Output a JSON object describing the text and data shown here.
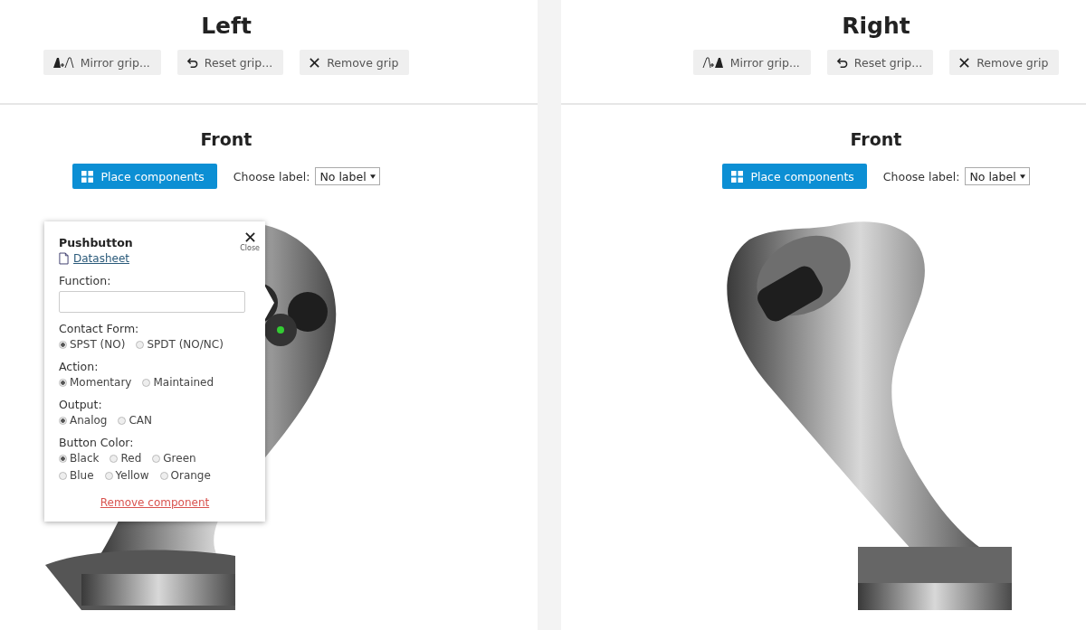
{
  "panels": [
    {
      "title": "Left",
      "buttons": [
        {
          "kind": "mirror",
          "label": "Mirror grip..."
        },
        {
          "kind": "reset",
          "label": "Reset grip..."
        },
        {
          "kind": "remove",
          "label": "Remove grip"
        }
      ],
      "view": {
        "title": "Front",
        "place_button": "Place components",
        "label_caption": "Choose label:",
        "label_value": "No label"
      },
      "popup": {
        "title": "Pushbutton",
        "close": "Close",
        "datasheet": "Datasheet",
        "function_label": "Function:",
        "groups": [
          {
            "label": "Contact Form:",
            "options": [
              {
                "label": "SPST (NO)",
                "selected": true
              },
              {
                "label": "SPDT (NO/NC)",
                "selected": false
              }
            ]
          },
          {
            "label": "Action:",
            "options": [
              {
                "label": "Momentary",
                "selected": true
              },
              {
                "label": "Maintained",
                "selected": false
              }
            ]
          },
          {
            "label": "Output:",
            "options": [
              {
                "label": "Analog",
                "selected": true
              },
              {
                "label": "CAN",
                "selected": false
              }
            ]
          },
          {
            "label": "Button Color:",
            "options": [
              {
                "label": "Black",
                "selected": true
              },
              {
                "label": "Red",
                "selected": false
              },
              {
                "label": "Green",
                "selected": false
              },
              {
                "label": "Blue",
                "selected": false
              },
              {
                "label": "Yellow",
                "selected": false
              },
              {
                "label": "Orange",
                "selected": false
              }
            ]
          }
        ],
        "remove": "Remove component"
      }
    },
    {
      "title": "Right",
      "buttons": [
        {
          "kind": "mirror",
          "label": "Mirror grip..."
        },
        {
          "kind": "reset",
          "label": "Reset grip..."
        },
        {
          "kind": "remove",
          "label": "Remove grip"
        }
      ],
      "view": {
        "title": "Front",
        "place_button": "Place components",
        "label_caption": "Choose label:",
        "label_value": "No label"
      }
    }
  ]
}
